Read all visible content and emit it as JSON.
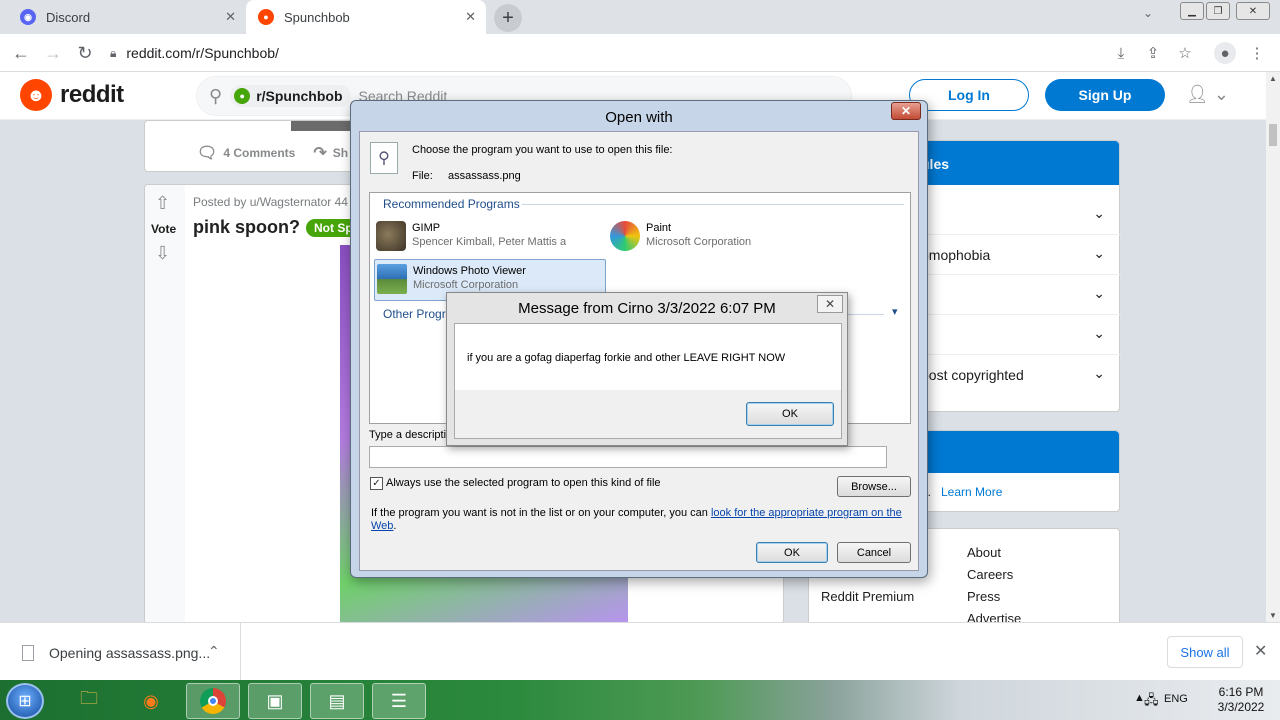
{
  "browser": {
    "tabs": [
      {
        "label": "Discord",
        "icon": "discord-icon",
        "color": "#5865f2"
      },
      {
        "label": "Spunchbob",
        "icon": "reddit-icon",
        "color": "#ff4500"
      }
    ],
    "new_tab": "+",
    "url": "reddit.com/r/Spunchbob/"
  },
  "reddit": {
    "logo_text": "reddit",
    "search": {
      "community": "r/Spunchbob",
      "placeholder": "Search Reddit"
    },
    "login": "Log In",
    "signup": "Sign Up",
    "accent": "#0079d3",
    "post1": {
      "comments": "4 Comments",
      "share": "Sh"
    },
    "post2": {
      "vote_label": "Vote",
      "meta": "Posted by u/Wagsternator 44",
      "title": "pink spoon?",
      "flair": "Not Spu"
    },
    "sidebar": {
      "rules_header": "ules",
      "rules": [
        "",
        "omophobia",
        "",
        "",
        "post copyrighted"
      ],
      "mod_text": "n.",
      "learn_more": "Learn More",
      "footer_links": [
        "About",
        "Careers",
        "Press",
        "Advertise"
      ],
      "premium": "Reddit Premium"
    }
  },
  "open_with": {
    "title": "Open with",
    "instruction": "Choose the program you want to use to open this file:",
    "file_label": "File:",
    "file_name": "assassass.png",
    "recommended_label": "Recommended Programs",
    "programs": [
      {
        "name": "GIMP",
        "company": "Spencer Kimball, Peter Mattis a"
      },
      {
        "name": "Paint",
        "company": "Microsoft Corporation"
      },
      {
        "name": "Windows Photo Viewer",
        "company": "Microsoft Corporation"
      }
    ],
    "other_label": "Other Progra",
    "desc_label": "Type a descriptio",
    "always_use": "Always use the selected program to open this kind of file",
    "always_checked": true,
    "browse": "Browse...",
    "help_prefix": "If the program you want is not in the list or on your computer, you can ",
    "help_link": "look for the appropriate program on the Web",
    "help_suffix": ".",
    "ok": "OK",
    "cancel": "Cancel"
  },
  "message": {
    "title": "Message from Cirno 3/3/2022 6:07 PM",
    "text": "if you are a gofag diaperfag forkie and other LEAVE RIGHT NOW",
    "ok": "OK"
  },
  "downloads": {
    "file": "Opening assassass.png...",
    "show_all": "Show all"
  },
  "taskbar": {
    "lang": "ENG",
    "time": "6:16 PM",
    "date": "3/3/2022"
  }
}
